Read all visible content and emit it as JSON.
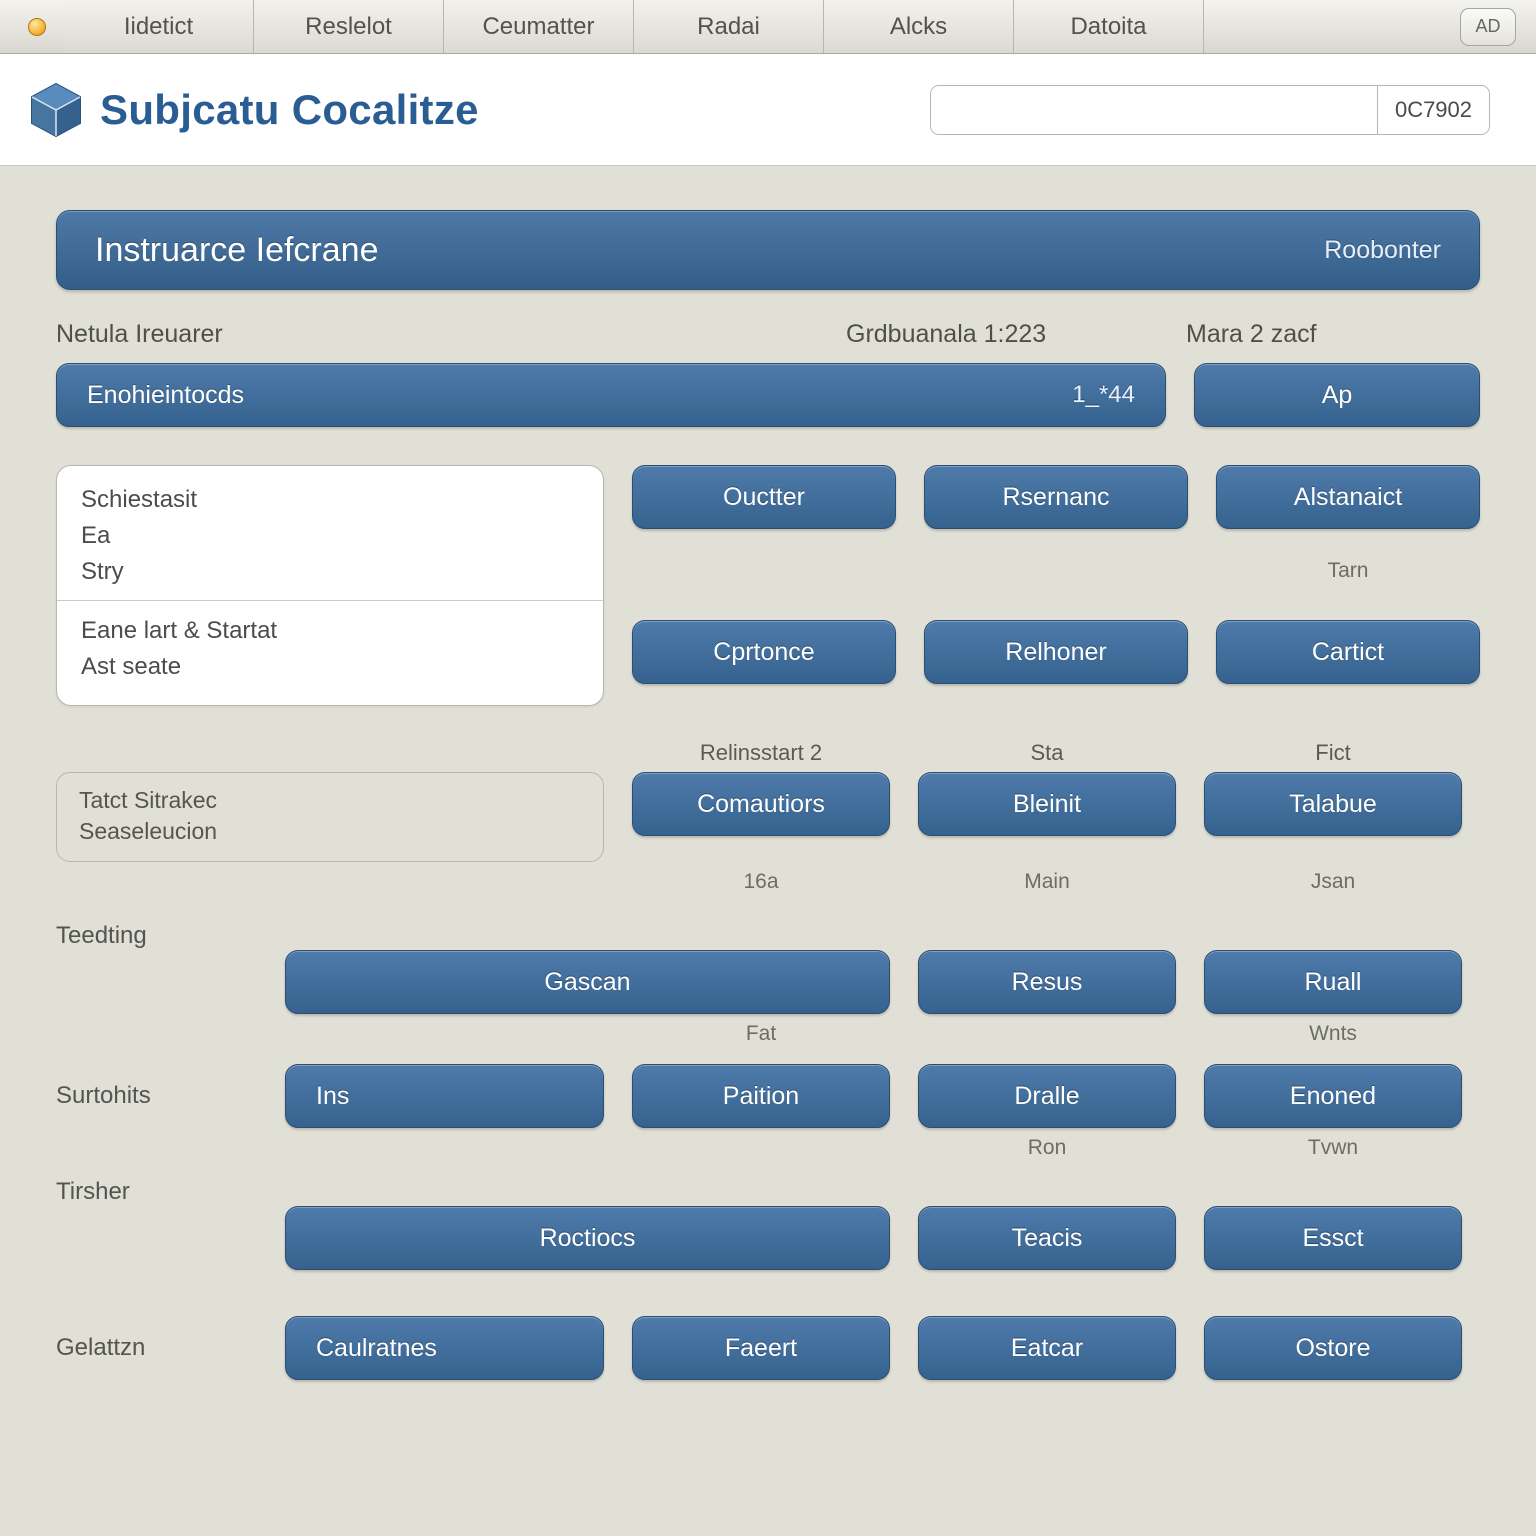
{
  "tabs": [
    "Iidetict",
    "Reslelot",
    "Ceumatter",
    "Radai",
    "Alcks",
    "Datoita"
  ],
  "extraBtn": "AD",
  "header": {
    "title": "Subjcatu Cocalitze",
    "searchCode": "0C7902"
  },
  "section": {
    "title": "Instruarce Iefcrane",
    "tag": "Roobonter"
  },
  "labels": {
    "c1": "Netula Ireuarer",
    "c2": "Grdbuanala 1:223",
    "c3": "Mara 2 zacf"
  },
  "valueBar": {
    "label": "Enohieintocds",
    "value": "1_*44",
    "side": "Ap"
  },
  "panel": {
    "l1": "Schiestasit",
    "l2": "Ea",
    "l3": "Stry",
    "l4": "Eane lart & Startat",
    "l5": "Ast seate"
  },
  "gridTop": {
    "r1": [
      "Ouctter",
      "Rsernanc",
      "Alstanaict"
    ],
    "note1": [
      "",
      "",
      "Tarn"
    ],
    "r2": [
      "Cprtonce",
      "Relhoner",
      "Cartict"
    ]
  },
  "obox": {
    "l1": "Tatct Sitrakec",
    "l2": "Seaseleucion"
  },
  "gridMid": {
    "hdr": [
      "Relinsstart 2",
      "Sta",
      "Fict"
    ],
    "r1": [
      "Comautiors",
      "Bleinit",
      "Talabue"
    ],
    "note": [
      "16a",
      "Main",
      "Jsan"
    ]
  },
  "lower": [
    {
      "label": "Teedting",
      "mainLabel": "Gascan",
      "b2": "Resus",
      "b3": "Ruall",
      "notes": [
        "",
        "Fat",
        "",
        "Wnts"
      ]
    },
    {
      "label": "Surtohits",
      "main": "Ins",
      "mainLabel": "Paition",
      "b2": "Dralle",
      "b3": "Enoned",
      "notes": [
        "",
        "",
        "Ron",
        "Tvwn"
      ]
    },
    {
      "label": "Tirsher",
      "mainLabel": "Roctiocs",
      "b2": "Teacis",
      "b3": "Essct",
      "notes": [
        "",
        "",
        "",
        ""
      ]
    },
    {
      "label": "Gelattzn",
      "main": "Caulratnes",
      "mainLabel": "Faeert",
      "b2": "Eatcar",
      "b3": "Ostore",
      "notes": [
        "",
        "",
        "",
        ""
      ]
    }
  ]
}
